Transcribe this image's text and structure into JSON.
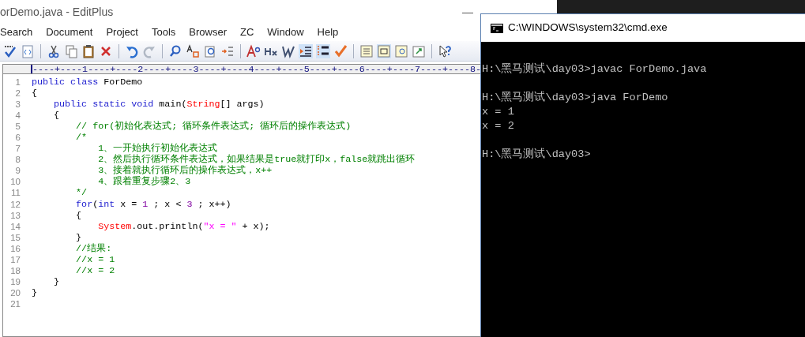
{
  "editor_window": {
    "title": "orDemo.java - EditPlus",
    "minimize": "—",
    "menu": [
      {
        "label": "Search"
      },
      {
        "label": "Document"
      },
      {
        "label": "Project"
      },
      {
        "label": "Tools"
      },
      {
        "label": "Browser"
      },
      {
        "label": "ZC"
      },
      {
        "label": "Window"
      },
      {
        "label": "Help"
      }
    ],
    "ruler": "----+----1----+----2----+----3----+----4----+----5----+----6----+----7----+----8-",
    "lines": [
      {
        "number": "1",
        "tokens": [
          {
            "kind": "keyword",
            "text": "public"
          },
          {
            "kind": "keyword",
            "text": " class"
          },
          {
            "kind": "plain",
            "text": " ForDemo"
          }
        ]
      },
      {
        "number": "2",
        "tokens": [
          {
            "kind": "plain",
            "text": "{"
          }
        ]
      },
      {
        "number": "3",
        "tokens": [
          {
            "kind": "keyword",
            "text": "    public"
          },
          {
            "kind": "keyword",
            "text": " static"
          },
          {
            "kind": "keyword",
            "text": " void"
          },
          {
            "kind": "plain",
            "text": " main("
          },
          {
            "kind": "class",
            "text": "String"
          },
          {
            "kind": "plain",
            "text": "[] args)"
          }
        ]
      },
      {
        "number": "4",
        "tokens": [
          {
            "kind": "plain",
            "text": "    {"
          }
        ]
      },
      {
        "number": "5",
        "tokens": [
          {
            "kind": "comment",
            "text": "        // for(初始化表达式; 循环条件表达式; 循环后的操作表达式)"
          }
        ]
      },
      {
        "number": "6",
        "tokens": [
          {
            "kind": "comment",
            "text": "        /*"
          }
        ]
      },
      {
        "number": "7",
        "tokens": [
          {
            "kind": "comment",
            "text": "            1、一开始执行初始化表达式"
          }
        ]
      },
      {
        "number": "8",
        "tokens": [
          {
            "kind": "comment",
            "text": "            2、然后执行循环条件表达式，如果结果是true就打印x，false就跳出循环"
          }
        ]
      },
      {
        "number": "9",
        "tokens": [
          {
            "kind": "comment",
            "text": "            3、接着就执行循环后的操作表达式，x++"
          }
        ]
      },
      {
        "number": "10",
        "tokens": [
          {
            "kind": "comment",
            "text": "            4、跟着重复步骤2、3"
          }
        ]
      },
      {
        "number": "11",
        "tokens": [
          {
            "kind": "comment",
            "text": "        */"
          }
        ]
      },
      {
        "number": "12",
        "tokens": [
          {
            "kind": "keyword",
            "text": "        for"
          },
          {
            "kind": "plain",
            "text": "("
          },
          {
            "kind": "keyword",
            "text": "int"
          },
          {
            "kind": "plain",
            "text": " x = "
          },
          {
            "kind": "number",
            "text": "1"
          },
          {
            "kind": "plain",
            "text": " ; x < "
          },
          {
            "kind": "number",
            "text": "3"
          },
          {
            "kind": "plain",
            "text": " ; x++)"
          }
        ]
      },
      {
        "number": "13",
        "tokens": [
          {
            "kind": "plain",
            "text": "        {"
          }
        ]
      },
      {
        "number": "14",
        "tokens": [
          {
            "kind": "class",
            "text": "            System"
          },
          {
            "kind": "plain",
            "text": ".out.println("
          },
          {
            "kind": "string",
            "text": "\"x = \""
          },
          {
            "kind": "plain",
            "text": " + x);"
          }
        ]
      },
      {
        "number": "15",
        "tokens": [
          {
            "kind": "plain",
            "text": "        }"
          }
        ]
      },
      {
        "number": "16",
        "tokens": [
          {
            "kind": "comment",
            "text": "        //结果:"
          }
        ]
      },
      {
        "number": "17",
        "tokens": [
          {
            "kind": "comment",
            "text": "        //x = 1"
          }
        ]
      },
      {
        "number": "18",
        "tokens": [
          {
            "kind": "comment",
            "text": "        //x = 2"
          }
        ]
      },
      {
        "number": "19",
        "tokens": [
          {
            "kind": "plain",
            "text": "    }"
          }
        ]
      },
      {
        "number": "20",
        "tokens": [
          {
            "kind": "plain",
            "text": "}"
          }
        ]
      },
      {
        "number": "21"
      }
    ]
  },
  "console_window": {
    "title": "C:\\WINDOWS\\system32\\cmd.exe",
    "blocks": [
      [
        "H:\\黑马测试\\day03>javac ForDemo.java"
      ],
      [
        "H:\\黑马测试\\day03>java ForDemo",
        "x = 1",
        "x = 2"
      ],
      [
        "H:\\黑马测试\\day03>"
      ]
    ]
  }
}
